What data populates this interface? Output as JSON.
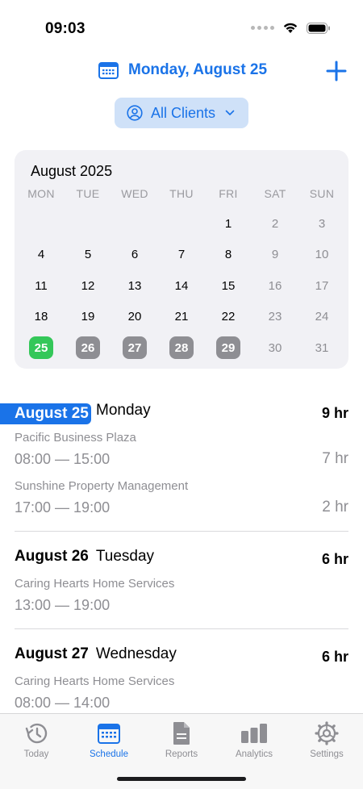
{
  "status_bar": {
    "time": "09:03"
  },
  "header": {
    "date_title": "Monday, August 25"
  },
  "filter": {
    "label": "All Clients"
  },
  "calendar": {
    "title": "August 2025",
    "weekdays": [
      "MON",
      "TUE",
      "WED",
      "THU",
      "FRI",
      "SAT",
      "SUN"
    ],
    "weeks": [
      [
        "",
        "",
        "",
        "",
        "1",
        "2",
        "3"
      ],
      [
        "4",
        "5",
        "6",
        "7",
        "8",
        "9",
        "10"
      ],
      [
        "11",
        "12",
        "13",
        "14",
        "15",
        "16",
        "17"
      ],
      [
        "18",
        "19",
        "20",
        "21",
        "22",
        "23",
        "24"
      ],
      [
        "25",
        "26",
        "27",
        "28",
        "29",
        "30",
        "31"
      ]
    ],
    "today": "25",
    "booked_days": [
      "26",
      "27",
      "28",
      "29"
    ]
  },
  "schedule": [
    {
      "date": "August 25",
      "weekday": "Monday",
      "total": "9 hr",
      "highlight": true,
      "entries": [
        {
          "client": "Pacific Business Plaza",
          "time": "08:00 — 15:00",
          "duration": "7 hr"
        },
        {
          "client": "Sunshine Property Management",
          "time": "17:00 — 19:00",
          "duration": "2 hr"
        }
      ]
    },
    {
      "date": "August 26",
      "weekday": "Tuesday",
      "total": "6 hr",
      "highlight": false,
      "entries": [
        {
          "client": "Caring Hearts Home Services",
          "time": "13:00 — 19:00",
          "duration": ""
        }
      ]
    },
    {
      "date": "August 27",
      "weekday": "Wednesday",
      "total": "6 hr",
      "highlight": false,
      "entries": [
        {
          "client": "Caring Hearts Home Services",
          "time": "08:00 — 14:00",
          "duration": ""
        }
      ]
    }
  ],
  "tabs": [
    {
      "label": "Today",
      "icon": "clock-history-icon",
      "active": false
    },
    {
      "label": "Schedule",
      "icon": "calendar-icon",
      "active": true
    },
    {
      "label": "Reports",
      "icon": "document-icon",
      "active": false
    },
    {
      "label": "Analytics",
      "icon": "bar-chart-icon",
      "active": false
    },
    {
      "label": "Settings",
      "icon": "gear-icon",
      "active": false
    }
  ],
  "colors": {
    "accent": "#1a73e8",
    "today": "#34c759",
    "booked": "#8e8e93",
    "filter_bg": "#cfe1f8",
    "calendar_bg": "#f1f1f5"
  }
}
